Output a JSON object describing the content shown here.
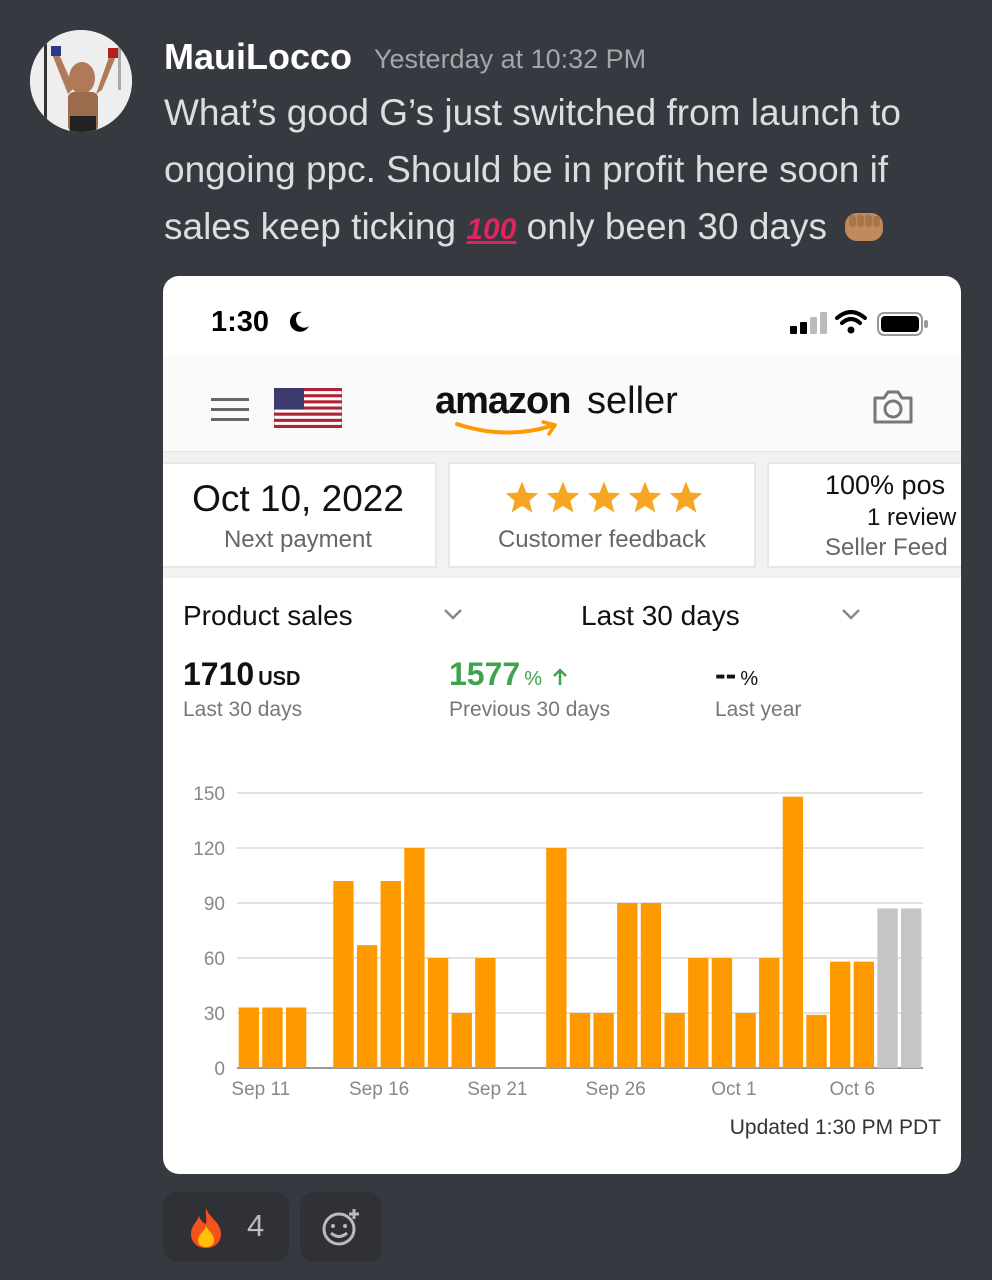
{
  "post": {
    "username": "MauiLocco",
    "timestamp": "Yesterday at 10:32 PM",
    "line1": "What’s good G’s just switched from launch to",
    "line2": "ongoing ppc.  Should be in profit here soon if",
    "line3a": "sales keep ticking",
    "emoji_100": "100",
    "line3b": "only been 30 days"
  },
  "phone": {
    "status_time": "1:30",
    "app_logo": {
      "word1": "amazon",
      "word2": "seller"
    },
    "tiles": {
      "payment_date": "Oct 10, 2022",
      "payment_label": "Next payment",
      "feedback_label": "Customer feedback",
      "feedback_stars": 5,
      "feedback_pct": "100% pos",
      "feedback_reviews": "1 review",
      "feedback_sub": "Seller Feed"
    },
    "sales": {
      "metric_selector": "Product sales",
      "range_selector": "Last 30 days",
      "current_value": "1710",
      "current_unit": "USD",
      "current_label": "Last 30 days",
      "previous_value": "1577",
      "previous_unit": "%",
      "previous_label": "Previous 30 days",
      "year_value": "--",
      "year_unit": "%",
      "year_label": "Last year",
      "updated": "Updated 1:30 PM PDT"
    }
  },
  "chart_data": {
    "type": "bar",
    "ylim": [
      0,
      150
    ],
    "yticks": [
      "0",
      "30",
      "60",
      "90",
      "120",
      "150"
    ],
    "x_tick_labels": [
      "Sep 11",
      "Sep 16",
      "Sep 21",
      "Sep 26",
      "Oct 1",
      "Oct 6"
    ],
    "values": [
      33,
      33,
      33,
      0,
      102,
      67,
      102,
      120,
      60,
      30,
      60,
      0,
      0,
      120,
      30,
      30,
      90,
      90,
      30,
      60,
      60,
      30,
      60,
      148,
      29,
      58,
      58,
      87,
      87
    ],
    "colors": {
      "actual": "#ff9900",
      "pending": "#c5c5c8"
    },
    "pending_from_index": 27
  },
  "reactions": {
    "fire_count": "4"
  }
}
